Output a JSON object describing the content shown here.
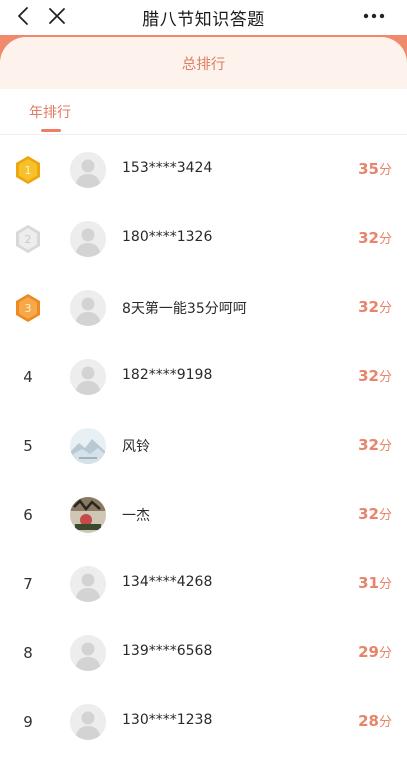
{
  "header": {
    "title": "腊八节知识答题"
  },
  "banner": {
    "label": "总排行"
  },
  "tabs": [
    {
      "label": "年排行",
      "active": true
    }
  ],
  "colors": {
    "accent": "#e8846a",
    "banner_bg": "#fdf3ec",
    "gold": "#f5b719",
    "silver": "#e0e0e0",
    "bronze": "#f39a3a"
  },
  "leaderboard": [
    {
      "rank": "1",
      "medal": "gold",
      "avatar": "default-avatar",
      "name": "153****3424",
      "score": "35",
      "unit": "分"
    },
    {
      "rank": "2",
      "medal": "silver",
      "avatar": "default-avatar",
      "name": "180****1326",
      "score": "32",
      "unit": "分"
    },
    {
      "rank": "3",
      "medal": "bronze",
      "avatar": "default-avatar",
      "name": "8天第一能35分呵呵",
      "score": "32",
      "unit": "分"
    },
    {
      "rank": "4",
      "medal": "",
      "avatar": "default-avatar",
      "name": "182****9198",
      "score": "32",
      "unit": "分"
    },
    {
      "rank": "5",
      "medal": "",
      "avatar": "landscape-avatar",
      "name": "风铃",
      "score": "32",
      "unit": "分"
    },
    {
      "rank": "6",
      "medal": "",
      "avatar": "photo-avatar",
      "name": "一杰",
      "score": "32",
      "unit": "分"
    },
    {
      "rank": "7",
      "medal": "",
      "avatar": "default-avatar",
      "name": "134****4268",
      "score": "31",
      "unit": "分"
    },
    {
      "rank": "8",
      "medal": "",
      "avatar": "default-avatar",
      "name": "139****6568",
      "score": "29",
      "unit": "分"
    },
    {
      "rank": "9",
      "medal": "",
      "avatar": "default-avatar",
      "name": "130****1238",
      "score": "28",
      "unit": "分"
    }
  ]
}
